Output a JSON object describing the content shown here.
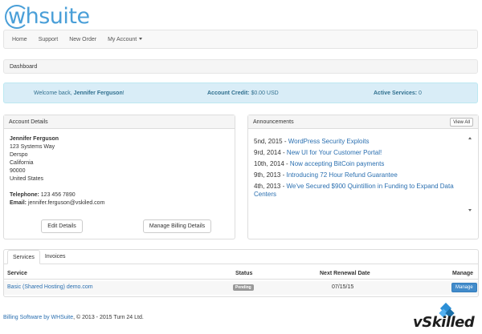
{
  "brand": {
    "logo_text": "whsuite"
  },
  "nav": [
    {
      "label": "Home"
    },
    {
      "label": "Support"
    },
    {
      "label": "New Order"
    },
    {
      "label": "My Account"
    }
  ],
  "breadcrumb": {
    "current": "Dashboard"
  },
  "welcome": {
    "prefix": "Welcome back, ",
    "user": "Jennifer Ferguson",
    "suffix": "!",
    "credit_label": "Account Credit:",
    "credit_value": "$0.00 USD",
    "services_label": "Active Services:",
    "services_value": "0"
  },
  "account": {
    "heading": "Account Details",
    "name": "Jennifer Ferguson",
    "address": [
      "123 Systems Way",
      "Derspo",
      "California",
      "90000",
      "United States"
    ],
    "telephone_label": "Telephone:",
    "telephone": "123 456 7890",
    "email_label": "Email:",
    "email": "jennifer.ferguson@vskiled.com",
    "edit_button": "Edit Details",
    "billing_button": "Manage Billing Details"
  },
  "announcements": {
    "heading": "Announcements",
    "view_all": "View All",
    "items": [
      {
        "date": "5nd, 2015",
        "title": "WordPress Security Exploits"
      },
      {
        "date": "9rd, 2014",
        "title": "New UI for Your Customer Portal!"
      },
      {
        "date": "10th, 2014",
        "title": "Now accepting BitCoin payments"
      },
      {
        "date": "9th, 2013",
        "title": "Introducing 72 Hour Refund Guarantee"
      },
      {
        "date": "4th, 2013",
        "title": "We've Secured $900 Quintillion in Funding to Expand Data Centers"
      }
    ]
  },
  "services": {
    "tabs": [
      "Services",
      "Invoices"
    ],
    "columns": [
      "Service",
      "Status",
      "Next Renewal Date",
      "Manage"
    ],
    "rows": [
      {
        "service": "Basic (Shared Hosting) demo.com",
        "status": "Pending",
        "renewal": "07/15/15",
        "action": "Manage"
      }
    ]
  },
  "footer": {
    "link": "Billing Software by WHSuite",
    "text": ", © 2013 - 2015 Turn 24 Ltd."
  },
  "watermark": {
    "text": "vSkilled"
  }
}
